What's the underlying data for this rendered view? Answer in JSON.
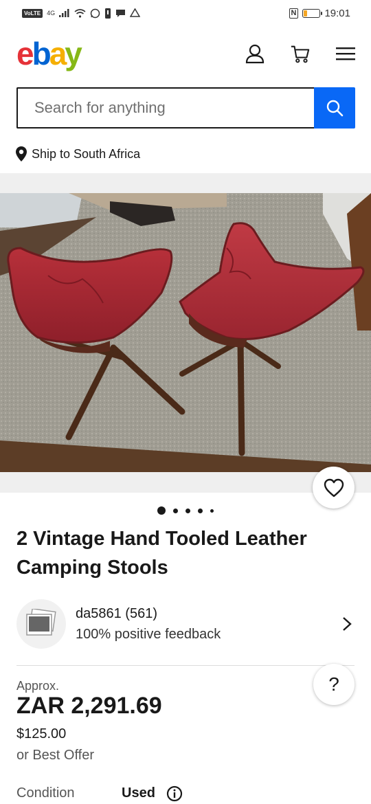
{
  "status_bar": {
    "left_badge": "VoLTE",
    "network": "4G",
    "time": "19:01",
    "nfc": "N",
    "battery_level": 0.2,
    "battery_color": "#f5a623"
  },
  "header": {
    "logo": {
      "e": "e",
      "b": "b",
      "a": "a",
      "y": "y"
    },
    "icons": [
      "account-icon",
      "cart-icon",
      "menu-icon"
    ]
  },
  "search": {
    "placeholder": "Search for anything",
    "button_color": "#0968f6"
  },
  "ship_to": {
    "label": "Ship to South Africa"
  },
  "gallery": {
    "image_count": 5,
    "active_index": 0
  },
  "item": {
    "title": "2 Vintage Hand Tooled Leather Camping Stools"
  },
  "seller": {
    "name": "da5861 (561)",
    "feedback": "100% positive feedback"
  },
  "pricing": {
    "approx_label": "Approx.",
    "price_local": "ZAR 2,291.69",
    "price_usd": "$125.00",
    "offer_text": "or Best Offer"
  },
  "condition": {
    "label": "Condition",
    "value": "Used"
  },
  "help": {
    "label": "?"
  },
  "colors": {
    "logo_e": "#e53238",
    "logo_b": "#0064d2",
    "logo_a": "#f5af02",
    "logo_y": "#86b817"
  }
}
